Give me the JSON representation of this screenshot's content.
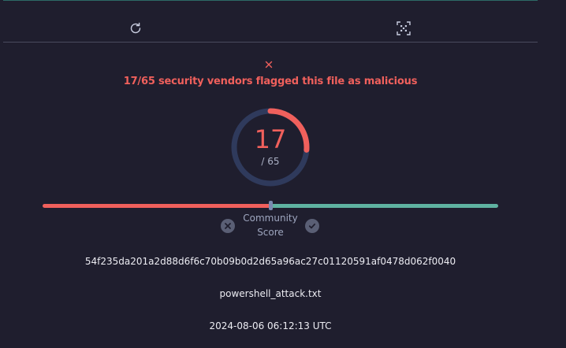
{
  "toolbar": {
    "reanalyze_icon": "refresh-icon",
    "similar_icon": "qr-grid-icon"
  },
  "verdict": {
    "icon": "close-icon",
    "text": "17/65 security vendors flagged this file as malicious",
    "color": "#f0605c"
  },
  "score": {
    "detections": "17",
    "total_label": "/ 65",
    "detections_value": 17,
    "total_value": 65
  },
  "community": {
    "label_line1": "Community",
    "label_line2": "Score",
    "downvote_icon": "x-circle-icon",
    "upvote_icon": "check-circle-icon",
    "negative_color": "#f0605c",
    "positive_color": "#5fb2a1"
  },
  "file": {
    "hash": "54f235da201a2d88d6f6c70b09b0d2d65a96ac27c01120591af0478d062f0040",
    "name": "powershell_attack.txt",
    "date": "2024-08-06 06:12:13 UTC"
  }
}
